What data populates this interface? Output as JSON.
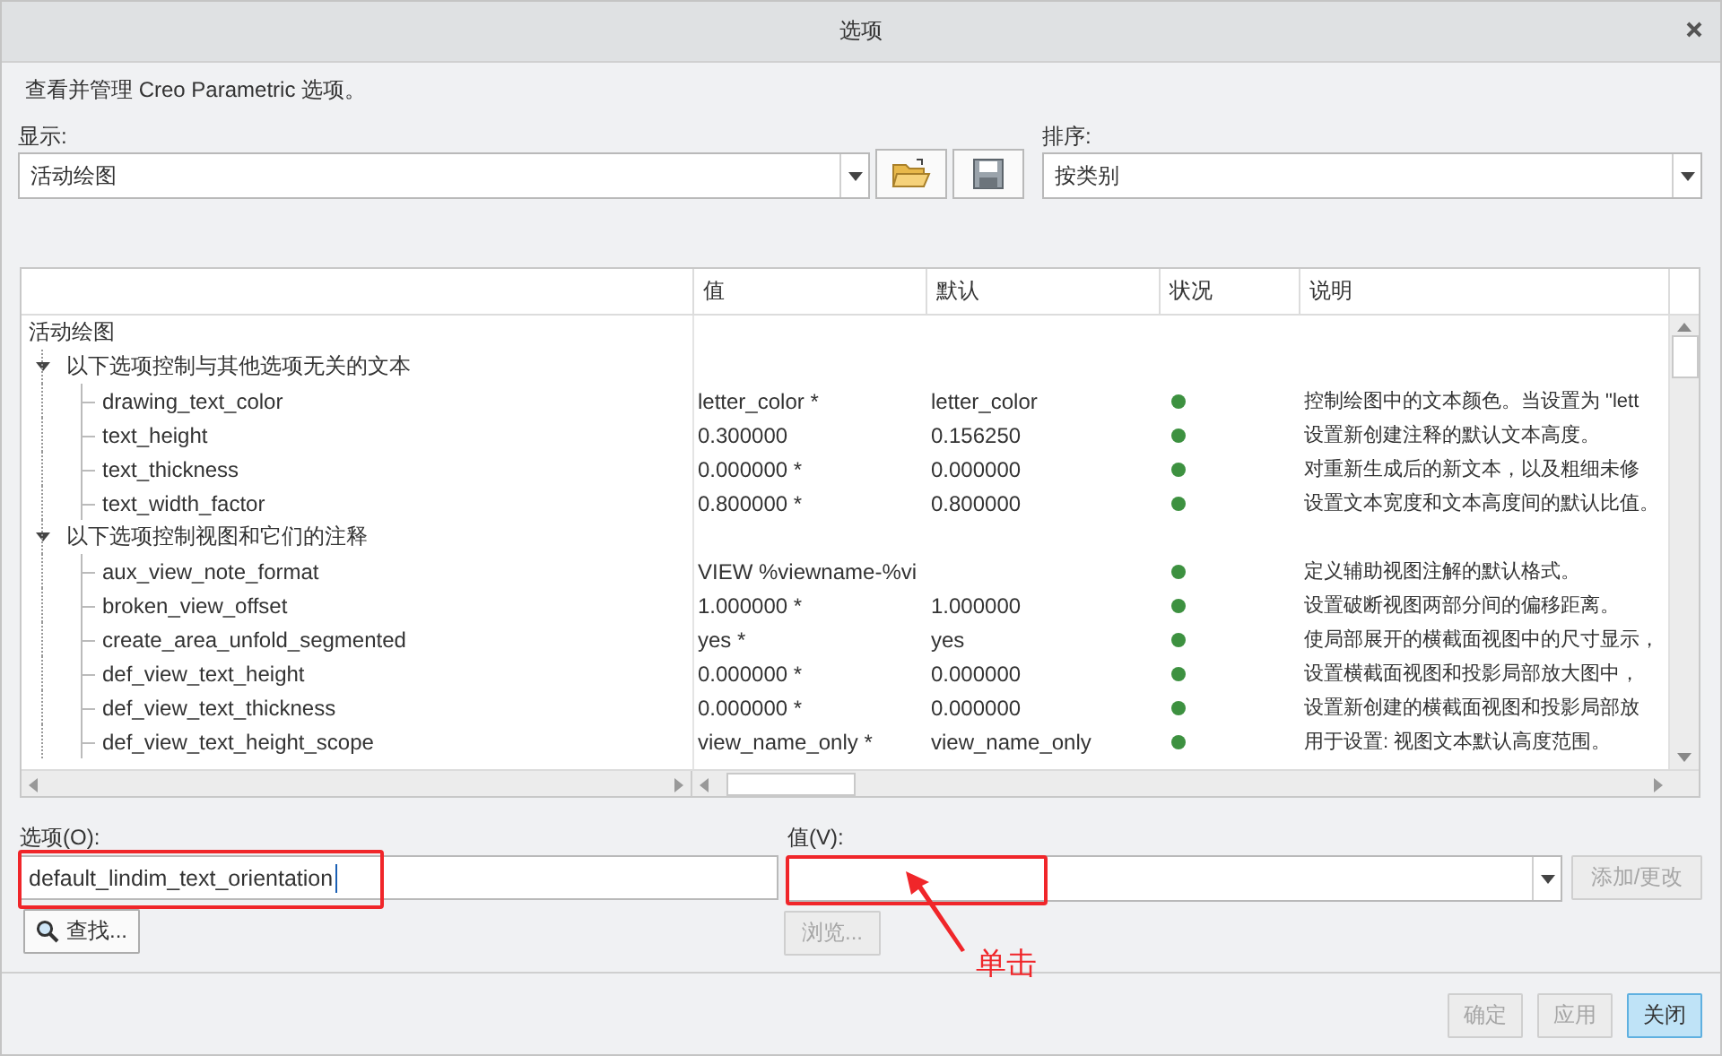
{
  "window": {
    "title": "选项"
  },
  "intro": "查看并管理 Creo Parametric 选项。",
  "display": {
    "label": "显示:",
    "value": "活动绘图"
  },
  "sort": {
    "label": "排序:",
    "value": "按类别"
  },
  "table": {
    "columns": [
      "值",
      "默认",
      "状况",
      "说明"
    ],
    "tree": [
      {
        "label": "活动绘图",
        "children": [
          {
            "label": "以下选项控制与其他选项无关的文本",
            "expanded": true,
            "children": [
              {
                "name": "drawing_text_color",
                "value": "letter_color *",
                "default": "letter_color",
                "color": "#3d9140",
                "description": "控制绘图中的文本颜色。当设置为 \"lett"
              },
              {
                "name": "text_height",
                "value": "0.300000",
                "default": "0.156250",
                "color": "#3d9140",
                "description": "设置新创建注释的默认文本高度。"
              },
              {
                "name": "text_thickness",
                "value": "0.000000 *",
                "default": "0.000000",
                "color": "#3d9140",
                "description": "对重新生成后的新文本，以及粗细未修"
              },
              {
                "name": "text_width_factor",
                "value": "0.800000 *",
                "default": "0.800000",
                "color": "#3d9140",
                "description": "设置文本宽度和文本高度间的默认比值。"
              }
            ]
          },
          {
            "label": "以下选项控制视图和它们的注释",
            "expanded": true,
            "children": [
              {
                "name": "aux_view_note_format",
                "value": "VIEW %viewname-%vi",
                "color": "#3d9140",
                "description": "定义辅助视图注解的默认格式。"
              },
              {
                "name": "broken_view_offset",
                "value": "1.000000 *",
                "default": "1.000000",
                "color": "#3d9140",
                "description": "设置破断视图两部分间的偏移距离。"
              },
              {
                "name": "create_area_unfold_segmented",
                "value": "yes *",
                "default": "yes",
                "color": "#3d9140",
                "description": "使局部展开的横截面视图中的尺寸显示，"
              },
              {
                "name": "def_view_text_height",
                "value": "0.000000 *",
                "default": "0.000000",
                "color": "#3d9140",
                "description": "设置横截面视图和投影局部放大图中，"
              },
              {
                "name": "def_view_text_thickness",
                "value": "0.000000 *",
                "default": "0.000000",
                "color": "#3d9140",
                "description": "设置新创建的横截面视图和投影局部放"
              },
              {
                "name": "def_view_text_height_scope",
                "value": "view_name_only *",
                "default": "view_name_only",
                "color": "#3d9140",
                "description": "用于设置: 视图文本默认高度范围。"
              }
            ]
          }
        ]
      }
    ]
  },
  "option_field": {
    "label": "选项(O):",
    "value": "default_lindim_text_orientation"
  },
  "value_field": {
    "label": "值(V):"
  },
  "find_button": {
    "label": "查找..."
  },
  "add_button": {
    "label": "添加/更改",
    "disabled": true
  },
  "browse_button": {
    "label": "浏览...",
    "disabled": true
  },
  "footer_buttons": [
    {
      "label": "确定",
      "disabled": true,
      "default": false
    },
    {
      "label": "应用",
      "disabled": true,
      "default": false
    },
    {
      "label": "关闭",
      "disabled": false,
      "default": true
    }
  ],
  "annotation": {
    "text": "单击"
  }
}
